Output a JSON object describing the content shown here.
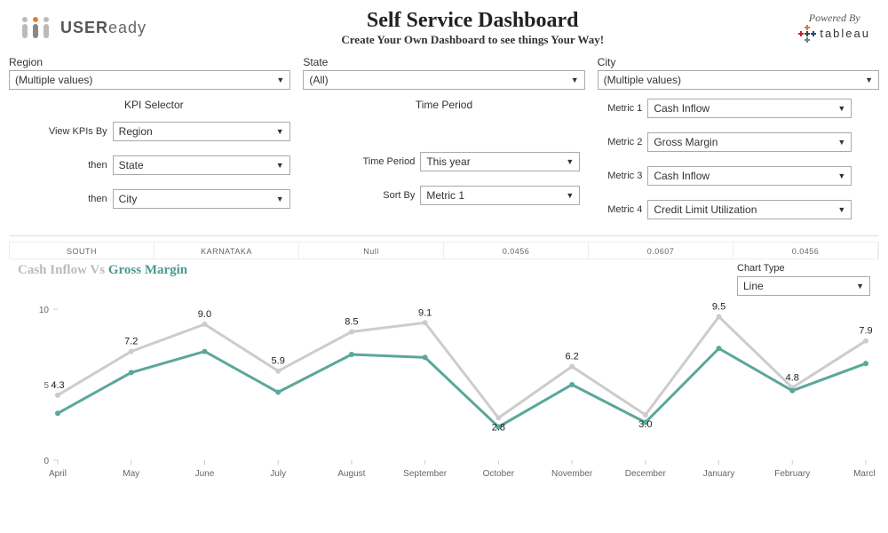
{
  "header": {
    "logo_text": "USEReady",
    "title": "Self Service Dashboard",
    "subtitle": "Create Your Own Dashboard to see things Your Way!",
    "powered_by": "Powered By",
    "tableau": "tableau"
  },
  "top_filters": {
    "region": {
      "label": "Region",
      "value": "(Multiple values)"
    },
    "state": {
      "label": "State",
      "value": "(All)"
    },
    "city": {
      "label": "City",
      "value": "(Multiple values)"
    }
  },
  "kpi_selector": {
    "heading": "KPI Selector",
    "view_by_label": "View KPIs By",
    "then_label": "then",
    "level1": "Region",
    "level2": "State",
    "level3": "City"
  },
  "time_period": {
    "heading": "Time Period",
    "period_label": "Time Period",
    "period_value": "This year",
    "sort_label": "Sort By",
    "sort_value": "Metric 1"
  },
  "metrics": {
    "m1": {
      "label": "Metric 1",
      "value": "Cash Inflow"
    },
    "m2": {
      "label": "Metric 2",
      "value": "Gross Margin"
    },
    "m3": {
      "label": "Metric 3",
      "value": "Cash Inflow"
    },
    "m4": {
      "label": "Metric 4",
      "value": "Credit Limit Utilization"
    }
  },
  "data_row": {
    "c1": "SOUTH",
    "c2": "KARNATAKA",
    "c3": "Null",
    "c4": "0.0456",
    "c5": "0.0607",
    "c6": "0.0456"
  },
  "chart": {
    "title_a": "Cash Inflow",
    "title_vs": " Vs ",
    "title_b": "Gross Margin",
    "type_label": "Chart Type",
    "type_value": "Line"
  },
  "chart_data": {
    "type": "line",
    "categories": [
      "April",
      "May",
      "June",
      "July",
      "August",
      "September",
      "October",
      "November",
      "December",
      "January",
      "February",
      "March"
    ],
    "series": [
      {
        "name": "Cash Inflow",
        "color": "#cccccc",
        "values": [
          4.3,
          7.2,
          9.0,
          5.9,
          8.5,
          9.1,
          2.8,
          6.2,
          3.0,
          9.5,
          4.8,
          7.9
        ]
      },
      {
        "name": "Gross Margin",
        "color": "#5aa79b",
        "values": [
          3.1,
          5.8,
          7.2,
          4.5,
          7.0,
          6.8,
          2.2,
          5.0,
          2.5,
          7.4,
          4.6,
          6.4
        ]
      }
    ],
    "ylim": [
      0,
      10
    ],
    "yticks": [
      0,
      5,
      10
    ],
    "xlabel": "",
    "ylabel": ""
  }
}
